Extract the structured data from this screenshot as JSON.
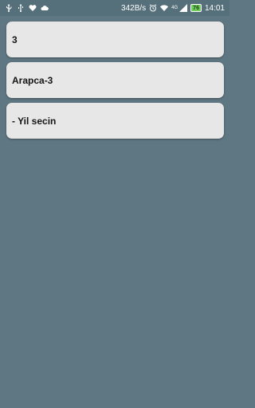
{
  "status_bar": {
    "left_icons": [
      "usb-icon",
      "usb-debug-icon",
      "heart-rate-icon",
      "cloud-icon"
    ],
    "network_speed": "342B/s",
    "network_label": "4G",
    "battery_level": "76",
    "time": "14:01"
  },
  "list": {
    "items": [
      {
        "label": "3"
      },
      {
        "label": "Arapca-3"
      },
      {
        "label": "- Yil secin"
      }
    ]
  },
  "colors": {
    "background": "#5f7782",
    "statusbar": "#56707b",
    "card": "#e7e7e7",
    "text": "#151515"
  }
}
